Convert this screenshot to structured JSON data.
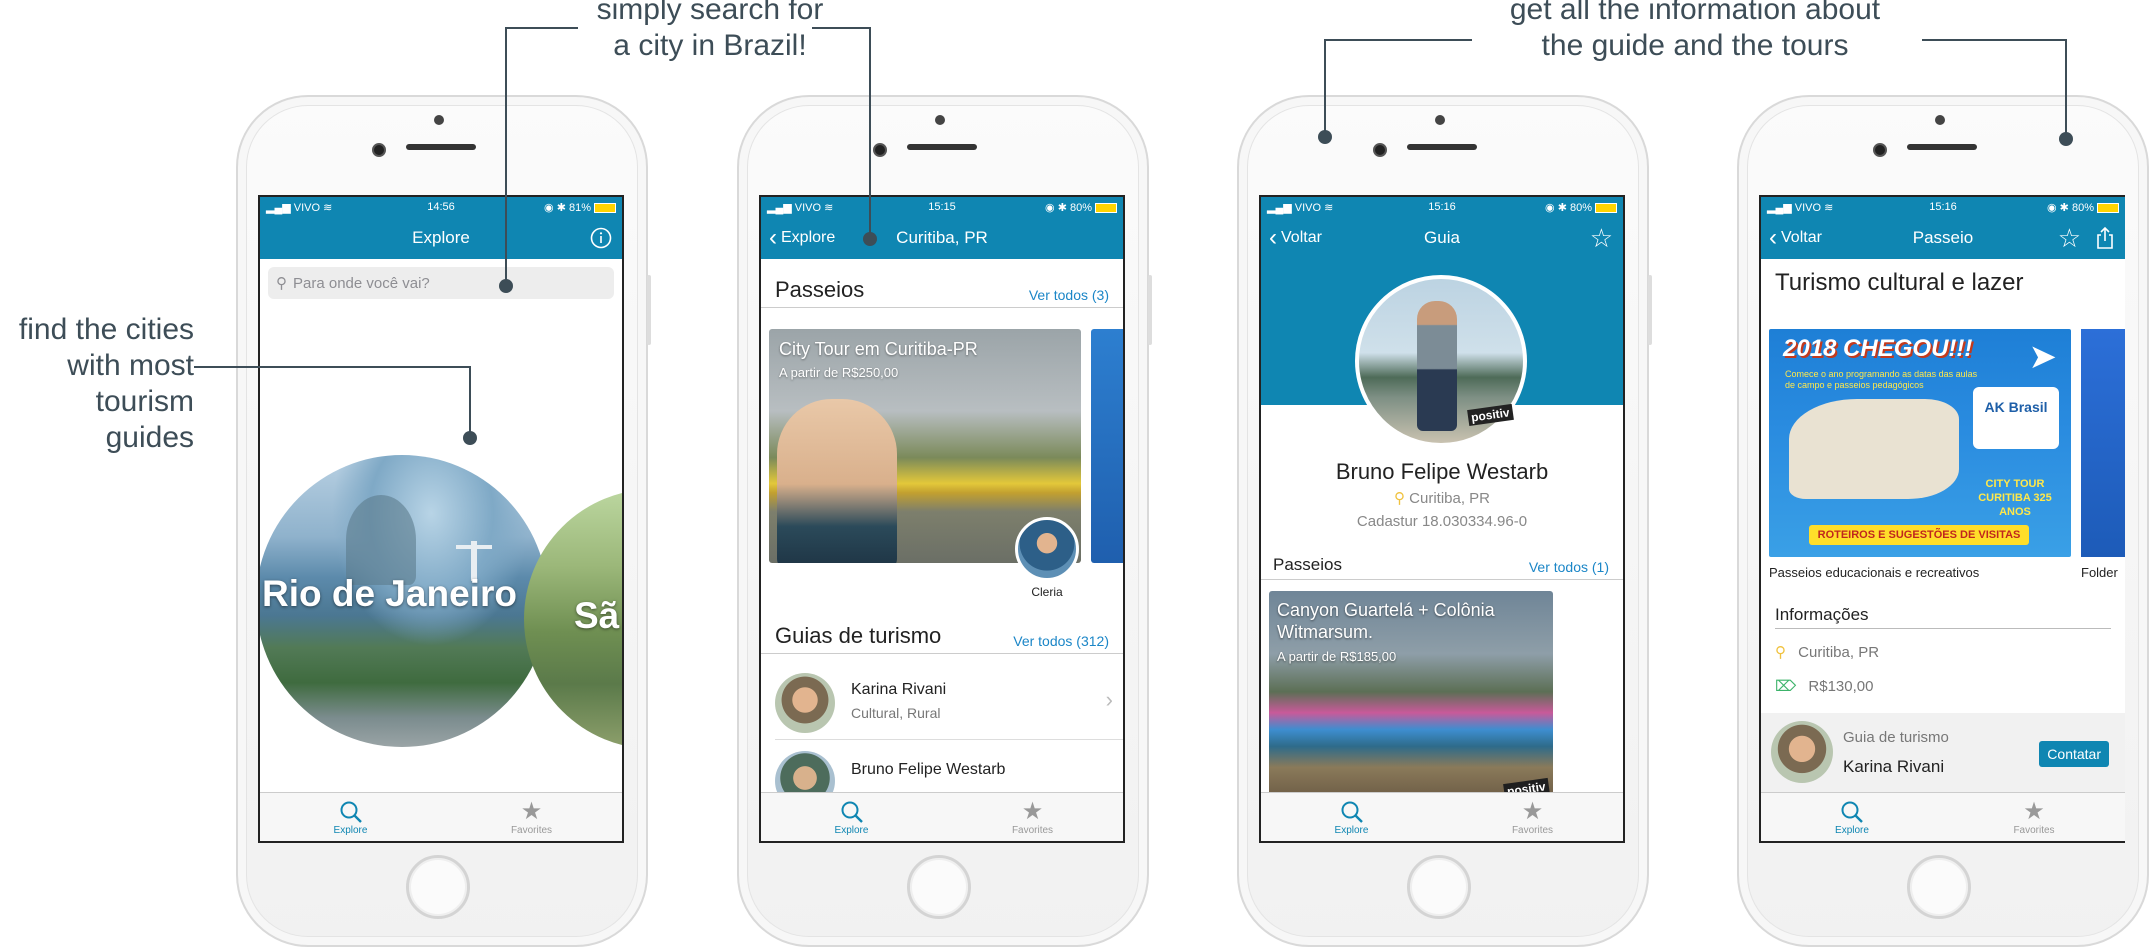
{
  "callouts": {
    "search": [
      "simply search for",
      "a city in Brazil!"
    ],
    "cities": [
      "find the cities",
      "with most",
      "tourism guides"
    ],
    "info": [
      "get all the information about",
      "the guide and the tours"
    ]
  },
  "tabs": {
    "explore": "Explore",
    "favorites": "Favorites"
  },
  "screen1": {
    "status": {
      "carrier": "VIVO",
      "time": "14:56",
      "battery": "81%"
    },
    "title": "Explore",
    "search_placeholder": "Para onde você vai?",
    "cities": [
      "Rio de Janeiro",
      "Sã"
    ]
  },
  "screen2": {
    "status": {
      "carrier": "VIVO",
      "time": "15:15",
      "battery": "80%"
    },
    "back": "Explore",
    "title": "Curitiba, PR",
    "tours_title": "Passeios",
    "tours_link": "Ver todos (3)",
    "tour_card": {
      "title": "City Tour em Curitiba-PR",
      "price": "A partir de R$250,00",
      "guide": "Cleria"
    },
    "guides_title": "Guias de turismo",
    "guides_link": "Ver todos (312)",
    "guides": [
      {
        "name": "Karina Rivani",
        "tags": "Cultural, Rural"
      },
      {
        "name": "Bruno Felipe Westarb",
        "tags": ""
      }
    ]
  },
  "screen3": {
    "status": {
      "carrier": "VIVO",
      "time": "15:16",
      "battery": "80%"
    },
    "back": "Voltar",
    "title": "Guia",
    "name": "Bruno Felipe Westarb",
    "city": "Curitiba, PR",
    "cadastur": "Cadastur 18.030334.96-0",
    "tours_title": "Passeios",
    "tours_link": "Ver todos (1)",
    "tour_card": {
      "title": "Canyon Guartelá + Colônia Witmarsum.",
      "price": "A partir de R$185,00"
    },
    "badge": "positiv"
  },
  "screen4": {
    "status": {
      "carrier": "VIVO",
      "time": "15:16",
      "battery": "80%"
    },
    "back": "Voltar",
    "title": "Passeio",
    "heading": "Turismo cultural e lazer",
    "flyer_headline": "2018 CHEGOU!!!",
    "flyer_text": "Comece o ano programando as datas das aulas de campo e passeios pedagógicos",
    "flyer_brand": "AK Brasil",
    "flyer_sticker": "CITY TOUR CURITIBA 325 ANOS",
    "flyer_banner": "ROTEIROS E SUGESTÕES DE VISITAS",
    "caption": "Passeios educacionais e recreativos",
    "caption2": "Folder",
    "info_title": "Informações",
    "city": "Curitiba, PR",
    "price": "R$130,00",
    "guide_label": "Guia de turismo",
    "guide_name": "Karina Rivani",
    "contact": "Contatar"
  },
  "colors": {
    "brand": "#0f86b2",
    "link": "#1b86c7",
    "callout": "#3d4d57"
  }
}
